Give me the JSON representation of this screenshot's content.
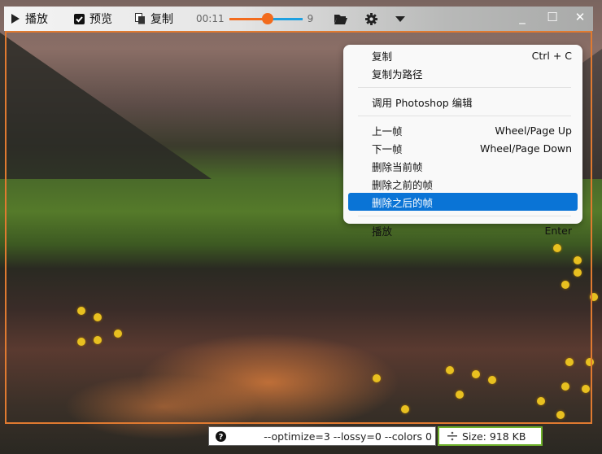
{
  "toolbar": {
    "play_label": "播放",
    "preview_label": "预览",
    "copy_label": "复制",
    "time": "00:11",
    "frame_count": "9",
    "slider_fraction": 0.45,
    "icons": [
      "play-icon",
      "checkbox-checked-icon",
      "copy-icon",
      "folder-open-icon",
      "gear-icon",
      "chevron-down-icon"
    ]
  },
  "window_controls": {
    "minimize": "_",
    "maximize": "☐",
    "close": "✕"
  },
  "context_menu": {
    "items": [
      {
        "label": "复制",
        "shortcut": "Ctrl + C"
      },
      {
        "label": "复制为路径",
        "shortcut": ""
      },
      {
        "label": "调用 Photoshop 编辑",
        "shortcut": ""
      },
      {
        "label": "上一帧",
        "shortcut": "Wheel/Page Up"
      },
      {
        "label": "下一帧",
        "shortcut": "Wheel/Page Down"
      },
      {
        "label": "删除当前帧",
        "shortcut": ""
      },
      {
        "label": "删除之前的帧",
        "shortcut": ""
      },
      {
        "label": "删除之后的帧",
        "shortcut": ""
      },
      {
        "label": "播放",
        "shortcut": "Enter"
      }
    ],
    "selected_index": 7
  },
  "status": {
    "command": "--optimize=3 --lossy=0 --colors 0",
    "size": "Size: 918 KB"
  },
  "colors": {
    "accent": "#f26b1d",
    "slider_rest": "#1ea0e0",
    "frame_border": "#e07a30",
    "selection": "#0a74d6",
    "size_border": "#6fb12b"
  }
}
